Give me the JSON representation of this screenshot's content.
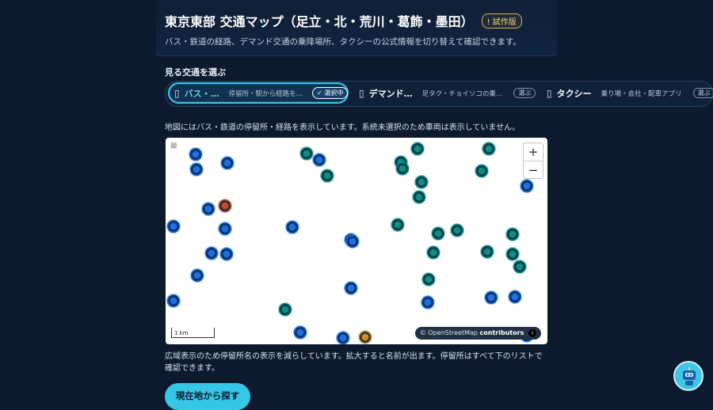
{
  "header": {
    "title": "東京東部 交通マップ（足立・北・荒川・葛飾・墨田）",
    "badge": "! 試作版",
    "subtitle": "バス・鉄道の経路、デマンド交通の乗降場所、タクシーの公式情報を切り替えて確認できます。"
  },
  "selector": {
    "label": "見る交通を選ぶ",
    "options": [
      {
        "icon": "bus-icon",
        "name": "バス・…",
        "desc": "停留所・駅から経路を…",
        "status": "✓ 選択中"
      },
      {
        "icon": "demand-icon",
        "name": "デマンド…",
        "desc": "足タク・チョイソコの乗…",
        "status": "選ぶ"
      },
      {
        "icon": "taxi-icon",
        "name": "タクシー",
        "desc": "乗り場・会社・配車アプリ",
        "status": "選ぶ"
      }
    ]
  },
  "map": {
    "note": "地図にはバス・鉄道の停留所・経路を表示しています。系統未選択のため車両は表示していません。",
    "zoom_in": "+",
    "zoom_out": "−",
    "scale": "1 km",
    "attribution_prefix": "© OpenStreetMap",
    "attribution_bold": "contributors",
    "colors": {
      "bus": "#1f6fe0",
      "rail": "#0f8f7a",
      "special_red": "#c84a1f",
      "special_orange": "#d88a1a"
    }
  },
  "footer": {
    "note": "広域表示のため停留所名の表示を減らしています。拡大すると名前が出ます。停留所はすべて下のリストで確認できます。",
    "locate_button": "現在地から探す"
  }
}
